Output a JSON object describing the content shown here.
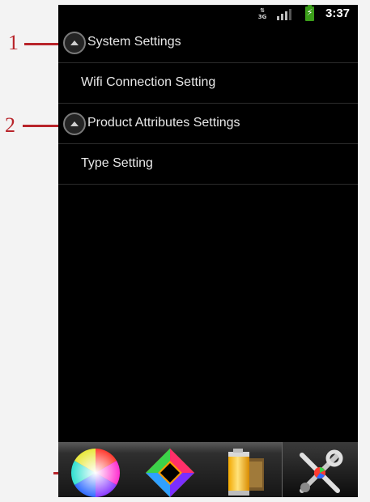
{
  "status_bar": {
    "network_label": "3G",
    "time": "3:37",
    "battery_glyph": "⚡"
  },
  "settings_list": [
    {
      "label": "System Settings",
      "type": "group",
      "expanded": true
    },
    {
      "label": "Wifi Connection Setting",
      "type": "item"
    },
    {
      "label": "Product Attributes Settings",
      "type": "group",
      "expanded": true
    },
    {
      "label": "Type Setting",
      "type": "item"
    }
  ],
  "tabs": [
    {
      "icon": "color-wheel-icon",
      "selected": false
    },
    {
      "icon": "color-diamond-icon",
      "selected": false
    },
    {
      "icon": "film-canister-icon",
      "selected": false
    },
    {
      "icon": "tools-icon",
      "selected": true
    }
  ],
  "callouts": [
    {
      "number": "1"
    },
    {
      "number": "2"
    }
  ],
  "colors": {
    "screen_background": "#000000",
    "text": "#e8e8e8",
    "callout": "#b8242a",
    "battery": "#3b9e1a"
  }
}
